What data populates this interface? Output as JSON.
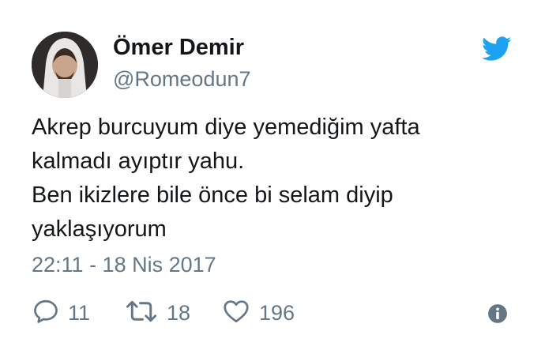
{
  "user": {
    "display_name": "Ömer Demir",
    "handle": "@Romeodun7"
  },
  "tweet": {
    "lines": [
      "Akrep burcuyum diye yemediğim yafta",
      "kalmadı ayıptır yahu.",
      "Ben ikizlere bile önce bi selam diyip",
      "yaklaşıyorum"
    ],
    "timestamp": "22:11 - 18 Nis 2017"
  },
  "actions": {
    "replies": "11",
    "retweets": "18",
    "likes": "196"
  },
  "colors": {
    "twitter_blue": "#1da1f2",
    "text": "#14171a",
    "secondary": "#657786"
  },
  "icons": {
    "brand": "twitter-bird-icon",
    "reply": "reply-icon",
    "retweet": "retweet-icon",
    "like": "heart-icon",
    "info": "info-icon"
  }
}
